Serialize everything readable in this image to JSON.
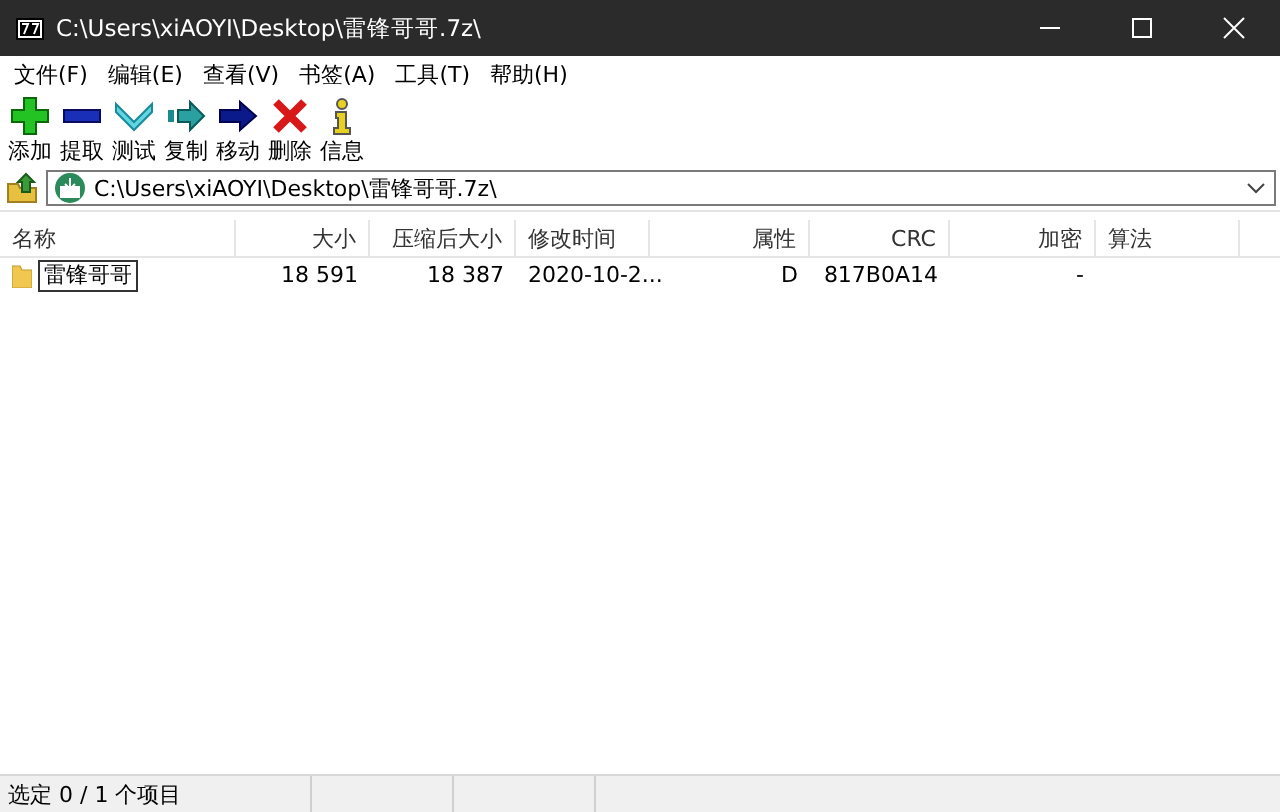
{
  "window": {
    "title": "C:\\Users\\xiAOYI\\Desktop\\雷锋哥哥.7z\\"
  },
  "menu": [
    "文件(F)",
    "编辑(E)",
    "查看(V)",
    "书签(A)",
    "工具(T)",
    "帮助(H)"
  ],
  "toolbar": [
    {
      "kind": "add",
      "label": "添加"
    },
    {
      "kind": "extract",
      "label": "提取"
    },
    {
      "kind": "test",
      "label": "测试"
    },
    {
      "kind": "copy",
      "label": "复制"
    },
    {
      "kind": "move",
      "label": "移动"
    },
    {
      "kind": "delete",
      "label": "删除"
    },
    {
      "kind": "info",
      "label": "信息"
    }
  ],
  "address": {
    "value": "C:\\Users\\xiAOYI\\Desktop\\雷锋哥哥.7z\\"
  },
  "table": {
    "columns": [
      "名称",
      "大小",
      "压缩后大小",
      "修改时间",
      "属性",
      "CRC",
      "加密",
      "算法"
    ],
    "rows": [
      {
        "kind": "folder",
        "editing": true,
        "cells": [
          "雷锋哥哥",
          "18 591",
          "18 387",
          "2020-10-2...",
          "D",
          "817B0A14",
          "-",
          ""
        ]
      }
    ]
  },
  "status_bar": [
    "选定 0 / 1 个项目"
  ]
}
